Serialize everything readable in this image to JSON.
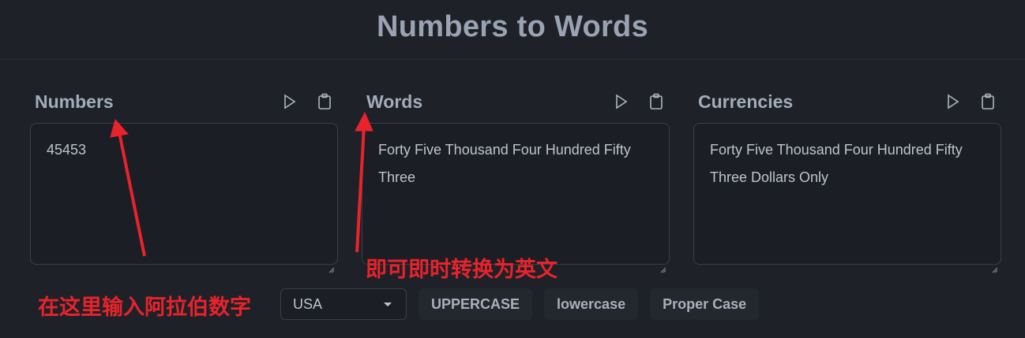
{
  "header": {
    "title": "Numbers to Words"
  },
  "panels": [
    {
      "label": "Numbers",
      "value": "45453"
    },
    {
      "label": "Words",
      "value": "Forty Five Thousand Four Hundred Fifty Three"
    },
    {
      "label": "Currencies",
      "value": "Forty Five Thousand Four Hundred Fifty Three Dollars Only"
    }
  ],
  "tool_icons": [
    "play-icon",
    "clipboard-icon"
  ],
  "controls": {
    "country": "USA",
    "uppercase": "UPPERCASE",
    "lowercase": "lowercase",
    "propercase": "Proper Case"
  },
  "annotations": {
    "input_hint": "在这里输入阿拉伯数字",
    "convert_hint": "即可即时转换为英文"
  },
  "colors": {
    "background": "#1e2128",
    "annotation": "#e8232b",
    "label": "#a3acba"
  }
}
